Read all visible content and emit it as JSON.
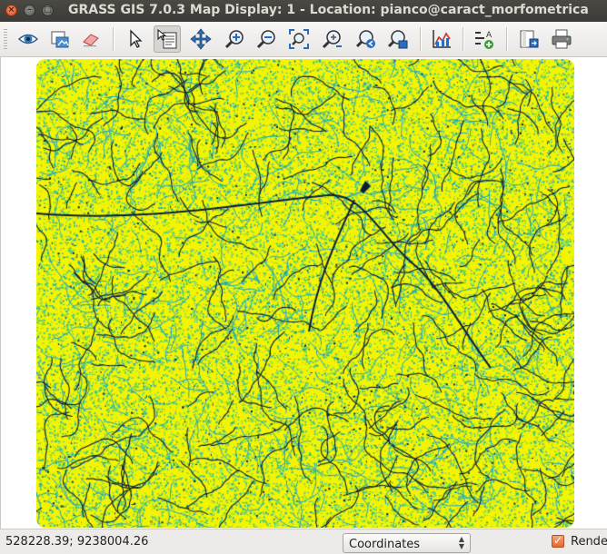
{
  "window": {
    "title": "GRASS GIS 7.0.3 Map Display: 1  - Location: pianco@caract_morfometrica",
    "close_glyph": "×",
    "minimize_glyph": "–",
    "maximize_glyph": "□"
  },
  "toolbar": {
    "buttons": [
      {
        "icon": "eye-icon",
        "name": "display-map-button"
      },
      {
        "icon": "render-map-icon",
        "name": "render-map-button"
      },
      {
        "icon": "eraser-icon",
        "name": "erase-display-button"
      },
      {
        "icon": "pointer-icon",
        "name": "pointer-button"
      },
      {
        "icon": "query-icon",
        "name": "query-button",
        "active": true
      },
      {
        "icon": "pan-icon",
        "name": "pan-button"
      },
      {
        "icon": "zoom-in-icon",
        "name": "zoom-in-button"
      },
      {
        "icon": "zoom-out-icon",
        "name": "zoom-out-button"
      },
      {
        "icon": "zoom-extent-icon",
        "name": "zoom-extent-button"
      },
      {
        "icon": "zoom-options-icon",
        "name": "zoom-options-button"
      },
      {
        "icon": "zoom-back-icon",
        "name": "zoom-back-button"
      },
      {
        "icon": "zoom-region-icon",
        "name": "zoom-region-button"
      },
      {
        "icon": "analyze-icon",
        "name": "analyze-button"
      },
      {
        "icon": "decoration-icon",
        "name": "add-decoration-button"
      },
      {
        "icon": "save-image-icon",
        "name": "save-image-button"
      },
      {
        "icon": "print-icon",
        "name": "print-button"
      }
    ]
  },
  "map": {
    "colors": {
      "yellow": "#f4f400",
      "green": "#37c88c",
      "cyan": "#19a5c8",
      "dark": "#0a1e3c"
    }
  },
  "status": {
    "coordinates": "528228.39; 9238004.26",
    "mode_select": "Coordinates",
    "render_label": "Rende",
    "render_checked": true
  }
}
